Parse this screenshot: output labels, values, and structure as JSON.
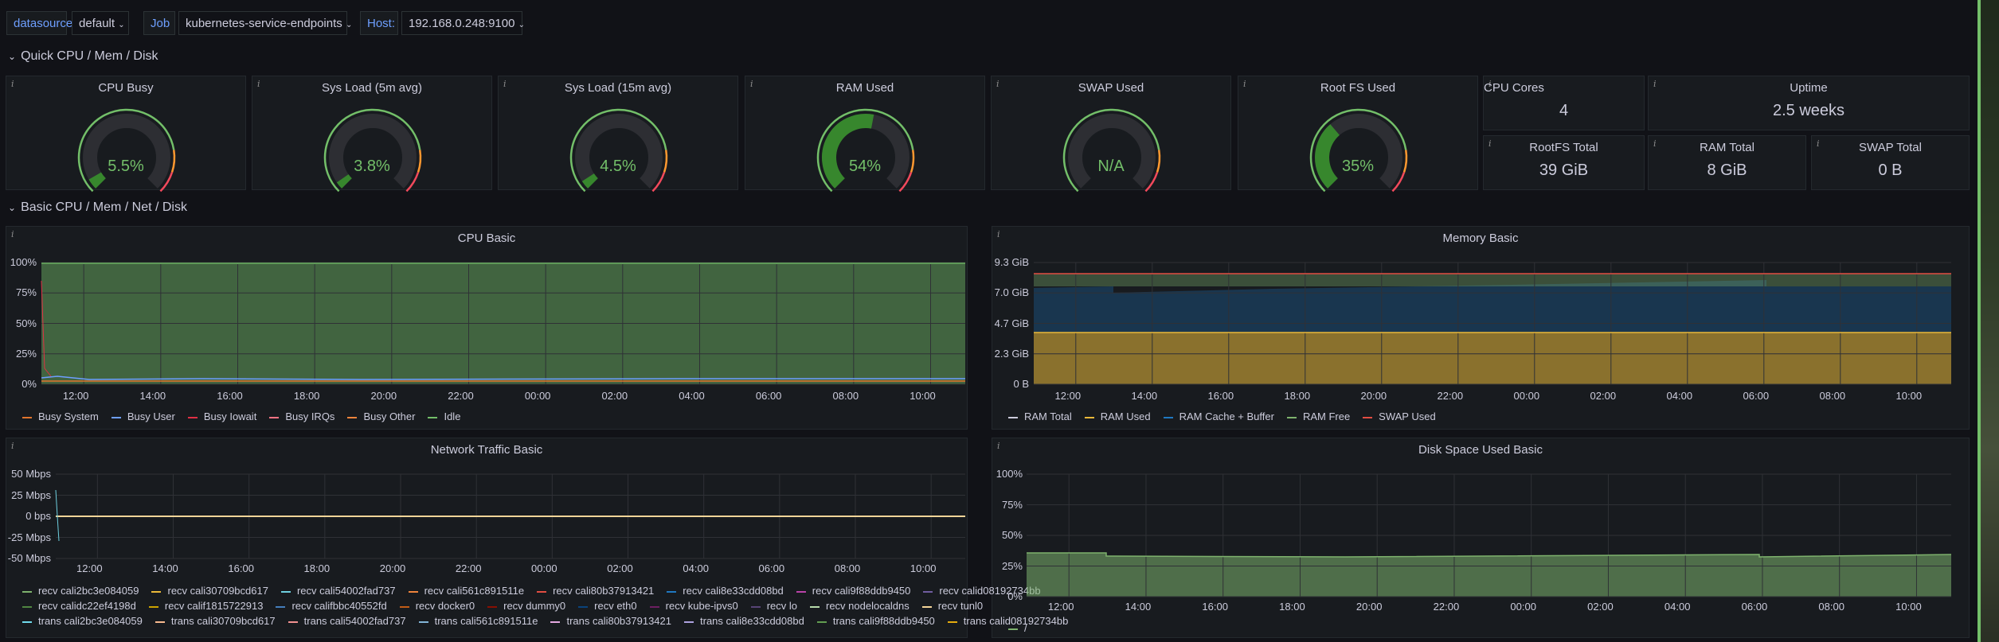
{
  "variables": [
    {
      "label": "datasource",
      "value": "default"
    },
    {
      "label": "Job",
      "value": "kubernetes-service-endpoints"
    },
    {
      "label": "Host:",
      "value": "192.168.0.248:9100"
    }
  ],
  "rows": {
    "quick": "Quick CPU / Mem / Disk",
    "basic": "Basic CPU / Mem / Net / Disk"
  },
  "gauges": [
    {
      "title": "CPU Busy",
      "value": "5.5%",
      "fraction": 0.055,
      "color": "#37872d"
    },
    {
      "title": "Sys Load (5m avg)",
      "value": "3.8%",
      "fraction": 0.038,
      "color": "#37872d"
    },
    {
      "title": "Sys Load (15m avg)",
      "value": "4.5%",
      "fraction": 0.045,
      "color": "#37872d"
    },
    {
      "title": "RAM Used",
      "value": "54%",
      "fraction": 0.54,
      "color": "#37872d"
    },
    {
      "title": "SWAP Used",
      "value": "N/A",
      "fraction": 0,
      "color": "#37872d"
    },
    {
      "title": "Root FS Used",
      "value": "35%",
      "fraction": 0.35,
      "color": "#37872d"
    }
  ],
  "stats": {
    "cpu_cores": {
      "title": "CPU Cores",
      "value": "4"
    },
    "uptime": {
      "title": "Uptime",
      "value": "2.5 weeks"
    },
    "rootfs_total": {
      "title": "RootFS Total",
      "value": "39 GiB"
    },
    "ram_total": {
      "title": "RAM Total",
      "value": "8 GiB"
    },
    "swap_total": {
      "title": "SWAP Total",
      "value": "0 B"
    }
  },
  "time_ticks": [
    "12:00",
    "14:00",
    "16:00",
    "18:00",
    "20:00",
    "22:00",
    "00:00",
    "02:00",
    "04:00",
    "06:00",
    "08:00",
    "10:00"
  ],
  "cpu_basic": {
    "title": "CPU Basic",
    "y_ticks": [
      "100%",
      "75%",
      "50%",
      "25%",
      "0%"
    ],
    "legend": [
      {
        "name": "Busy System",
        "color": "#e0752d"
      },
      {
        "name": "Busy User",
        "color": "#6e9fff"
      },
      {
        "name": "Busy Iowait",
        "color": "#e02f44"
      },
      {
        "name": "Busy IRQs",
        "color": "#ff7383"
      },
      {
        "name": "Busy Other",
        "color": "#ef843c"
      },
      {
        "name": "Idle",
        "color": "#73bf69"
      }
    ]
  },
  "memory_basic": {
    "title": "Memory Basic",
    "y_ticks": [
      "9.3 GiB",
      "7.0 GiB",
      "4.7 GiB",
      "2.3 GiB",
      "0 B"
    ],
    "legend": [
      {
        "name": "RAM Total",
        "color": "#ccccdc"
      },
      {
        "name": "RAM Used",
        "color": "#eab839"
      },
      {
        "name": "RAM Cache + Buffer",
        "color": "#1f78c1"
      },
      {
        "name": "RAM Free",
        "color": "#7eb26d"
      },
      {
        "name": "SWAP Used",
        "color": "#e24d42"
      }
    ]
  },
  "network_basic": {
    "title": "Network Traffic Basic",
    "y_ticks": [
      "50 Mbps",
      "25 Mbps",
      "0 bps",
      "-25 Mbps",
      "-50 Mbps"
    ],
    "legend_rows": [
      [
        {
          "name": "recv cali2bc3e084059",
          "color": "#7eb26d"
        },
        {
          "name": "recv cali30709bcd617",
          "color": "#eab839"
        },
        {
          "name": "recv cali54002fad737",
          "color": "#6ed0e0"
        },
        {
          "name": "recv cali561c891511e",
          "color": "#ef843c"
        },
        {
          "name": "recv cali80b37913421",
          "color": "#e24d42"
        },
        {
          "name": "recv cali8e33cdd08bd",
          "color": "#1f78c1"
        },
        {
          "name": "recv cali9f88ddb9450",
          "color": "#ba43a9"
        },
        {
          "name": "recv calid08192734bb",
          "color": "#705da0"
        }
      ],
      [
        {
          "name": "recv calidc22ef4198d",
          "color": "#508642"
        },
        {
          "name": "recv calif1815722913",
          "color": "#cca300"
        },
        {
          "name": "recv califbbc40552fd",
          "color": "#447ebc"
        },
        {
          "name": "recv docker0",
          "color": "#c15c17"
        },
        {
          "name": "recv dummy0",
          "color": "#890f02"
        },
        {
          "name": "recv eth0",
          "color": "#0a437c"
        },
        {
          "name": "recv kube-ipvs0",
          "color": "#6d1f62"
        },
        {
          "name": "recv lo",
          "color": "#584477"
        },
        {
          "name": "recv nodelocaldns",
          "color": "#b7dbab"
        },
        {
          "name": "recv tunl0",
          "color": "#f4d598"
        }
      ],
      [
        {
          "name": "trans cali2bc3e084059",
          "color": "#70dbed"
        },
        {
          "name": "trans cali30709bcd617",
          "color": "#f9ba8f"
        },
        {
          "name": "trans cali54002fad737",
          "color": "#f29191"
        },
        {
          "name": "trans cali561c891511e",
          "color": "#82b5d8"
        },
        {
          "name": "trans cali80b37913421",
          "color": "#e5a8e2"
        },
        {
          "name": "trans cali8e33cdd08bd",
          "color": "#aea2e0"
        },
        {
          "name": "trans cali9f88ddb9450",
          "color": "#629e51"
        },
        {
          "name": "trans calid08192734bb",
          "color": "#e5ac0e"
        }
      ]
    ]
  },
  "disk_basic": {
    "title": "Disk Space Used Basic",
    "y_ticks": [
      "100%",
      "75%",
      "50%",
      "25%",
      "0%"
    ],
    "legend": [
      {
        "name": "/",
        "color": "#7eb26d"
      }
    ]
  },
  "colors": {
    "background": "#111217",
    "panel": "#181b1f",
    "green": "#73bf69",
    "yellow": "#eab839",
    "blue": "#1f78c1",
    "red": "#e24d42"
  }
}
